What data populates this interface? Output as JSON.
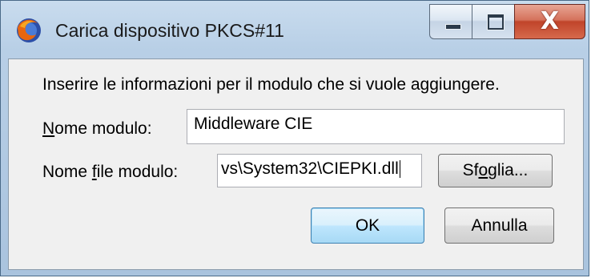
{
  "window": {
    "title": "Carica dispositivo PKCS#11",
    "app_icon": "firefox-icon",
    "controls": {
      "minimize": "minimize-icon",
      "maximize": "maximize-icon",
      "close_glyph": "X"
    }
  },
  "form": {
    "info_text": "Inserire le informazioni per il modulo che si vuole aggiungere.",
    "module_name": {
      "label_prefix": "",
      "label_accel": "N",
      "label_rest": "ome modulo:",
      "value": "Middleware CIE"
    },
    "module_file": {
      "label_prefix": "Nome ",
      "label_accel": "f",
      "label_rest": "ile modulo:",
      "value": "vs\\System32\\CIEPKI.dll"
    },
    "browse_button": {
      "prefix": "Sf",
      "accel": "o",
      "rest": "glia..."
    },
    "ok_button": "OK",
    "cancel_button": "Annulla"
  }
}
